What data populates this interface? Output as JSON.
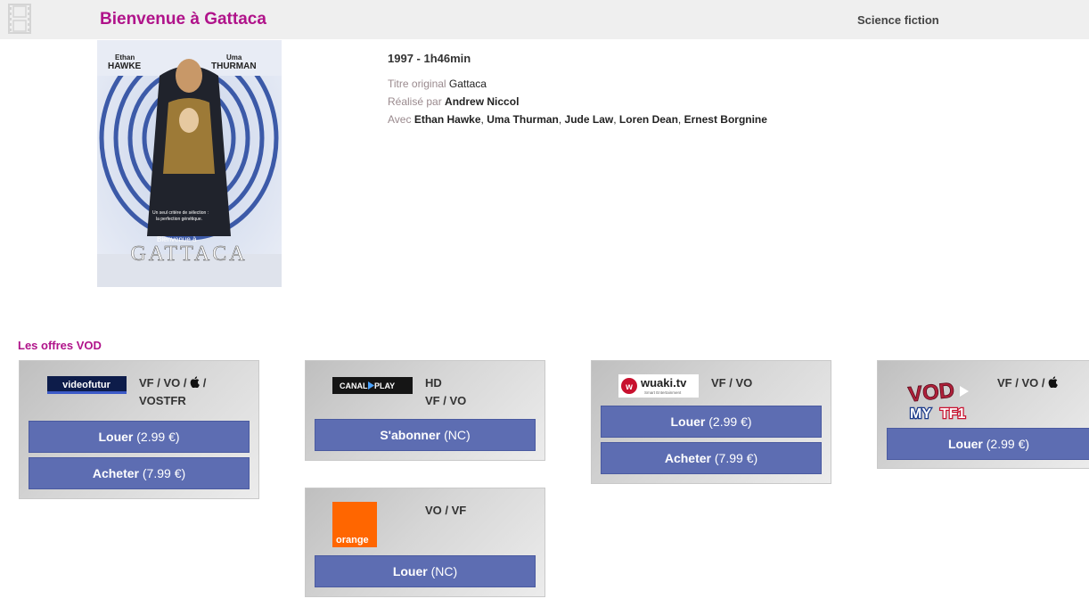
{
  "header": {
    "title": "Bienvenue à Gattaca",
    "genre": "Science fiction"
  },
  "poster": {
    "actor1_first": "Ethan",
    "actor1_last": "HAWKE",
    "actor2_first": "Uma",
    "actor2_last": "THURMAN",
    "tagline1": "Un seul critère de sélection :",
    "tagline2": "la perfection génétique.",
    "title_small": "Bienvenue à",
    "title_big": "GATTACA"
  },
  "movie": {
    "year_duration": "1997 - 1h46min",
    "original_title_label": "Titre original",
    "original_title": "Gattaca",
    "director_label": "Réalisé par",
    "director": "Andrew Niccol",
    "cast_label": "Avec",
    "cast": [
      "Ethan Hawke",
      "Uma Thurman",
      "Jude Law",
      "Loren Dean",
      "Ernest Borgnine"
    ]
  },
  "vod": {
    "section_title": "Les offres VOD",
    "offers": [
      {
        "provider": "videofutur",
        "versions_line1": "VF / VO / ",
        "versions_line1_end": " /",
        "versions_line2": "VOSTFR",
        "actions": [
          {
            "label": "Louer",
            "price": "(2.99 €)"
          },
          {
            "label": "Acheter",
            "price": "(7.99 €)"
          }
        ]
      },
      {
        "provider": "CANAL PLAY",
        "provider_a": "CANAL",
        "provider_b": "PLAY",
        "versions_line1": "HD",
        "versions_line2": "VF / VO",
        "actions": [
          {
            "label": "S'abonner",
            "price": "(NC)"
          }
        ]
      },
      {
        "provider": "orange",
        "versions_line1": "VO / VF",
        "actions": [
          {
            "label": "Louer",
            "price": "(NC)"
          }
        ]
      },
      {
        "provider": "wuaki.tv",
        "provider_tagline": "Smart Entertainment",
        "versions_line1": "VF / VO",
        "actions": [
          {
            "label": "Louer",
            "price": "(2.99 €)"
          },
          {
            "label": "Acheter",
            "price": "(7.99 €)"
          }
        ]
      },
      {
        "provider": "VOD MYTF1",
        "provider_a": "VOD",
        "provider_b": "MY",
        "provider_c": "TF1",
        "versions_line1": "VF / VO / ",
        "actions": [
          {
            "label": "Louer",
            "price": "(2.99 €)"
          }
        ]
      }
    ]
  },
  "colors": {
    "accent": "#b0138a",
    "button": "#5d6db2",
    "topbar": "#efefef"
  },
  "icons": [
    "film-icon",
    "apple-icon",
    "play-icon"
  ]
}
